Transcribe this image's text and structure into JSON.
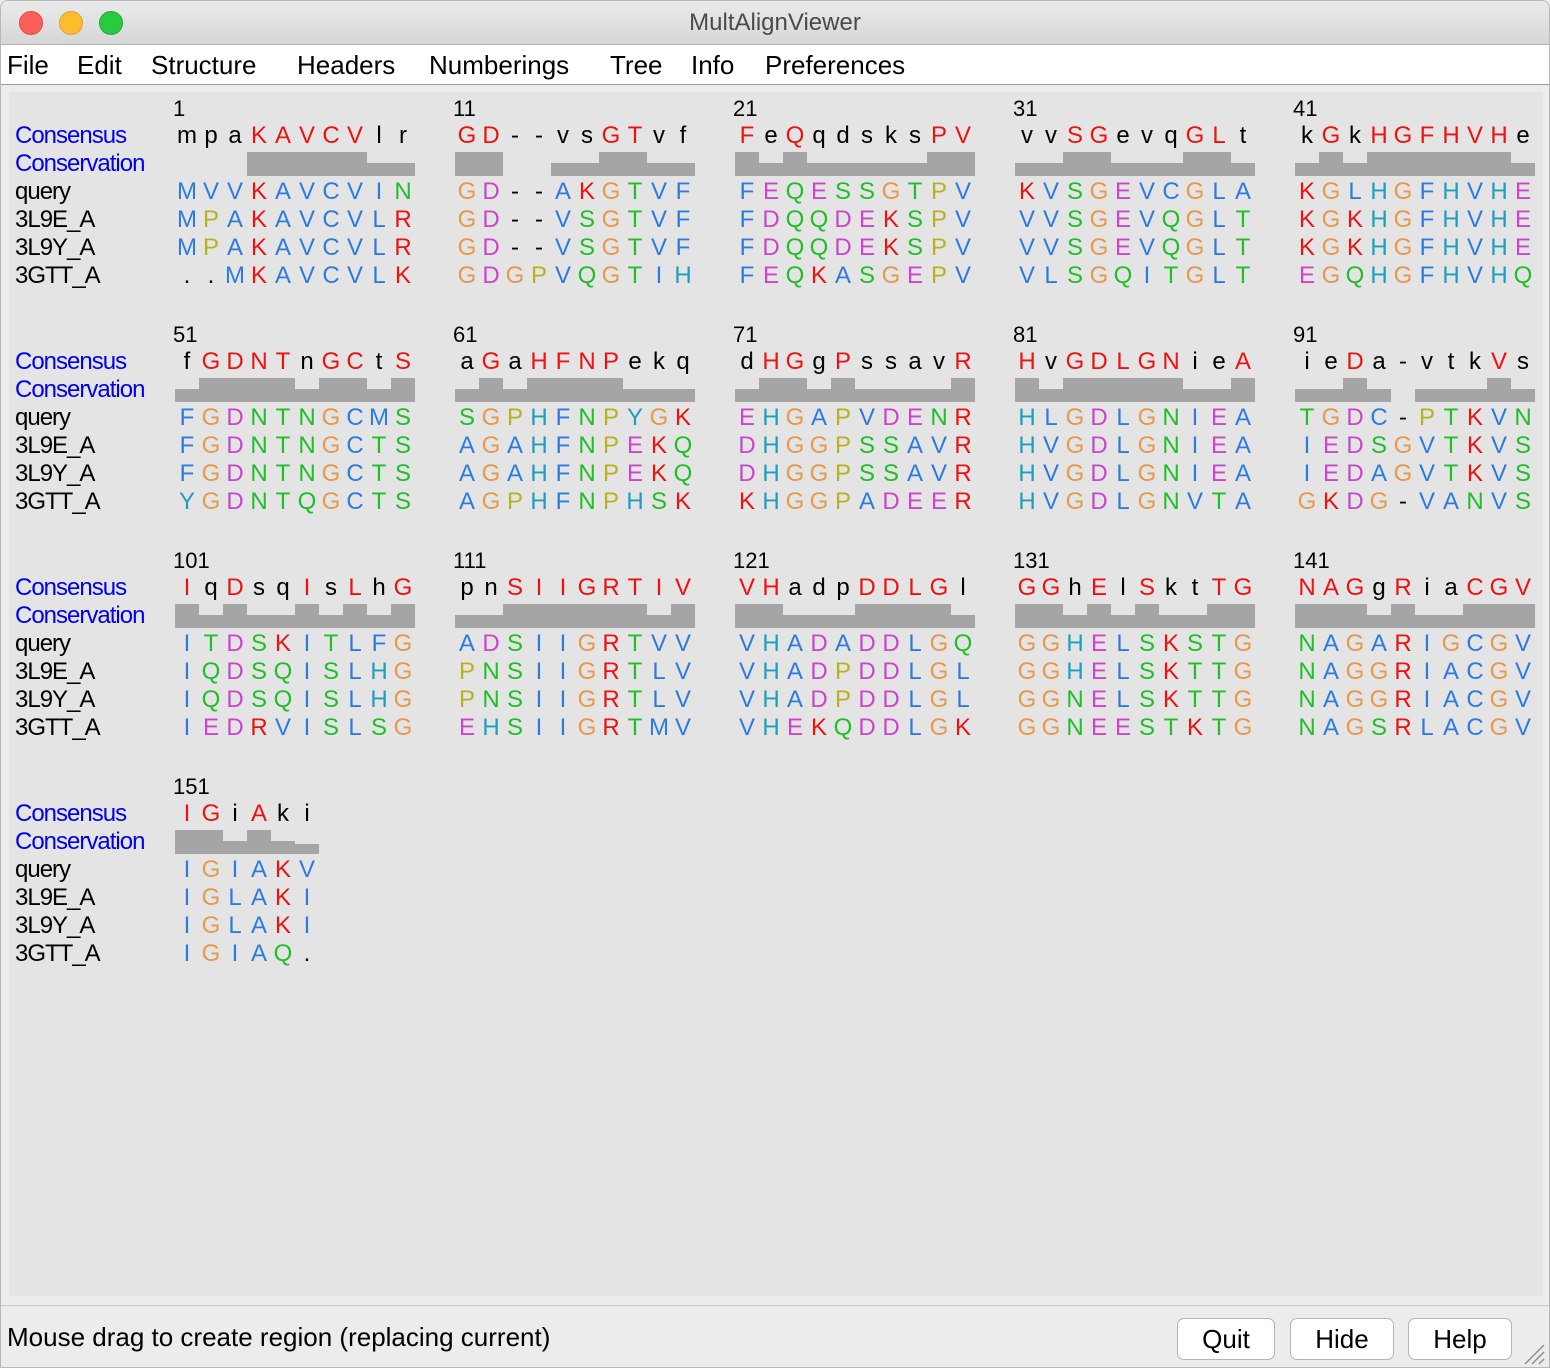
{
  "window": {
    "title": "MultAlignViewer"
  },
  "menu": [
    "File",
    "Edit",
    "Structure",
    "Headers",
    "Numberings",
    "Tree",
    "Info",
    "Preferences"
  ],
  "row_labels": {
    "consensus": "Consensus",
    "conservation": "Conservation"
  },
  "sequence_names": [
    "query",
    "3L9E_A",
    "3L9Y_A",
    "3GTT_A"
  ],
  "colors": {
    "header_label": "#0000ee",
    "conservation_bar": "#a5a5a5",
    "canvas": "#e4e4e4"
  },
  "residue_colors": {
    "red": "#ee1111",
    "blue": "#2e7be0",
    "cyan": "#1c9fbf",
    "green": "#1fbf28",
    "magenta": "#cc44cc",
    "orange": "#e69a4c",
    "olive": "#b8b21e",
    "black": "#000000"
  },
  "alignment": [
    {
      "start": 1,
      "consensus": "mpaKAVCVlr",
      "conservation": [
        0.0,
        0.0,
        0.0,
        1.0,
        1.0,
        1.0,
        1.0,
        1.0,
        0.55,
        0.55
      ],
      "seqs": [
        "MVVKAVCVIN",
        "MPAKAVCVLR",
        "MPAKAVCVLR",
        "..MKAVCVLK"
      ]
    },
    {
      "start": 11,
      "consensus": "GD--vsGTvf",
      "conservation": [
        1.0,
        1.0,
        0.0,
        0.0,
        0.55,
        0.55,
        1.0,
        1.0,
        0.55,
        0.55
      ],
      "seqs": [
        "GD--AKGTVF",
        "GD--VSGTVF",
        "GD--VSGTVF",
        "GDGPVQGTIH"
      ]
    },
    {
      "start": 21,
      "consensus": "FeQqdsksPV",
      "conservation": [
        1.0,
        0.55,
        1.0,
        0.55,
        0.55,
        0.55,
        0.55,
        0.55,
        1.0,
        1.0
      ],
      "seqs": [
        "FEQESSGTPV",
        "FDQQDEKSPV",
        "FDQQDEKSPV",
        "FEQKASGEPV"
      ]
    },
    {
      "start": 31,
      "consensus": "vvSGevqGLt",
      "conservation": [
        0.55,
        0.55,
        1.0,
        1.0,
        0.55,
        0.55,
        0.55,
        1.0,
        1.0,
        0.55
      ],
      "seqs": [
        "KVSGEVCGLA",
        "VVSGEVQGLT",
        "VVSGEVQGLT",
        "VLSGQITGLT"
      ]
    },
    {
      "start": 41,
      "consensus": "kGkHGFHVHe",
      "conservation": [
        0.55,
        1.0,
        0.55,
        1.0,
        1.0,
        1.0,
        1.0,
        1.0,
        1.0,
        0.55
      ],
      "seqs": [
        "KGLHGFHVHE",
        "KGKHGFHVHE",
        "KGKHGFHVHE",
        "EGQHGFHVHQ"
      ]
    },
    {
      "start": 51,
      "consensus": "fGDNTnGCtS",
      "conservation": [
        0.55,
        1.0,
        1.0,
        1.0,
        1.0,
        0.55,
        1.0,
        1.0,
        0.55,
        1.0
      ],
      "seqs": [
        "FGDNTNGCMS",
        "FGDNTNGCTS",
        "FGDNTNGCTS",
        "YGDNTQGCTS"
      ]
    },
    {
      "start": 61,
      "consensus": "aGaHFNPekq",
      "conservation": [
        0.55,
        1.0,
        0.55,
        1.0,
        1.0,
        1.0,
        1.0,
        0.55,
        0.55,
        0.55
      ],
      "seqs": [
        "SGPHFNPYGK",
        "AGAHFNPEKQ",
        "AGAHFNPEKQ",
        "AGPHFNPHSK"
      ]
    },
    {
      "start": 71,
      "consensus": "dHGgPssavR",
      "conservation": [
        0.55,
        1.0,
        1.0,
        0.55,
        1.0,
        0.55,
        0.55,
        0.55,
        0.55,
        1.0
      ],
      "seqs": [
        "EHGAPVDENR",
        "DHGGPSSAVR",
        "DHGGPSSAVR",
        "KHGGPADEER"
      ]
    },
    {
      "start": 81,
      "consensus": "HvGDLGNieA",
      "conservation": [
        1.0,
        0.55,
        1.0,
        1.0,
        1.0,
        1.0,
        1.0,
        0.55,
        0.55,
        1.0
      ],
      "seqs": [
        "HLGDLGNIEA",
        "HVGDLGNIEA",
        "HVGDLGNIEA",
        "HVGDLGNVTA"
      ]
    },
    {
      "start": 91,
      "consensus": "ieDa-vtkVs",
      "conservation": [
        0.55,
        0.55,
        1.0,
        0.55,
        0.0,
        0.55,
        0.55,
        0.55,
        1.0,
        0.55
      ],
      "seqs": [
        "TGDC-PTKVN",
        "IEDSGVTKVS",
        "IEDAGVTKVS",
        "GKDG-VANVS"
      ]
    },
    {
      "start": 101,
      "consensus": "IqDsqIsLhG",
      "conservation": [
        1.0,
        0.55,
        1.0,
        0.55,
        0.55,
        1.0,
        0.55,
        1.0,
        0.55,
        1.0
      ],
      "seqs": [
        "ITDSKITLFG",
        "IQDSQISLHG",
        "IQDSQISLHG",
        "IEDRVISLSG"
      ]
    },
    {
      "start": 111,
      "consensus": "pnSIIGRTIV",
      "conservation": [
        0.55,
        0.55,
        1.0,
        1.0,
        1.0,
        1.0,
        1.0,
        1.0,
        0.55,
        1.0
      ],
      "seqs": [
        "ADSIIGRTVV",
        "PNSIIGRTLV",
        "PNSIIGRTLV",
        "EHSIIGRTMV"
      ]
    },
    {
      "start": 121,
      "consensus": "VHadpDDLGl",
      "conservation": [
        1.0,
        1.0,
        0.55,
        0.55,
        0.55,
        1.0,
        1.0,
        1.0,
        1.0,
        0.55
      ],
      "seqs": [
        "VHADADDLGQ",
        "VHADPDDLGL",
        "VHADPDDLGL",
        "VHEKQDDLGK"
      ]
    },
    {
      "start": 131,
      "consensus": "GGhElSktTG",
      "conservation": [
        1.0,
        1.0,
        0.55,
        1.0,
        0.55,
        1.0,
        0.55,
        0.55,
        1.0,
        1.0
      ],
      "seqs": [
        "GGHELSKSTG",
        "GGHELSKTTG",
        "GGNELSKTTG",
        "GGNEESTKTG"
      ]
    },
    {
      "start": 141,
      "consensus": "NAGgRiaCGV",
      "conservation": [
        1.0,
        1.0,
        1.0,
        0.55,
        1.0,
        0.55,
        0.55,
        1.0,
        1.0,
        1.0
      ],
      "seqs": [
        "NAGARIGCGV",
        "NAGGRIACGV",
        "NAGGRIACGV",
        "NAGSRLACGV"
      ]
    },
    {
      "start": 151,
      "consensus": "IGiAki",
      "conservation": [
        1.0,
        1.0,
        0.55,
        1.0,
        0.55,
        0.4
      ],
      "seqs": [
        "IGIAKV",
        "IGLAKI",
        "IGLAKI",
        "IGIAQ."
      ]
    }
  ],
  "status": {
    "message": "Mouse drag to create region (replacing current)"
  },
  "buttons": {
    "quit": "Quit",
    "hide": "Hide",
    "help": "Help"
  }
}
